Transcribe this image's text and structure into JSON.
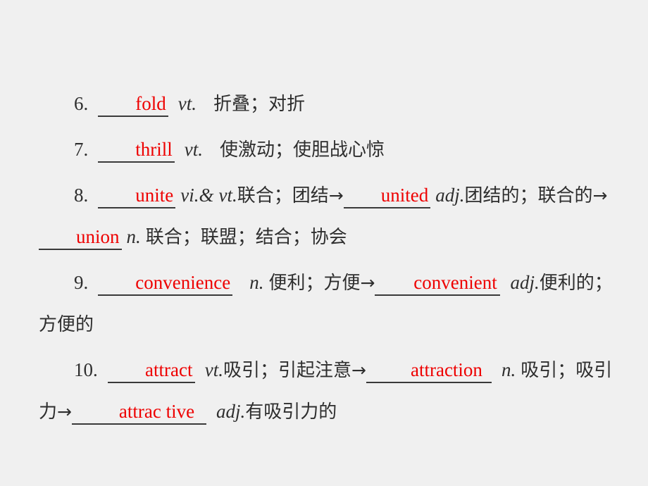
{
  "slide": {
    "background_color": "#f0f0f0",
    "answer_color": "#ee0000",
    "text_color": "#2e2e2e",
    "rule_color": "#3a3a3a",
    "arrow_glyph": "→"
  },
  "entries": [
    {
      "number": "6.",
      "answer": "fold",
      "pos": "vt.",
      "gloss": "折叠；对折",
      "derivations": []
    },
    {
      "number": "7.",
      "answer": "thrill",
      "pos": "vt.",
      "gloss": "使激动；使胆战心惊",
      "derivations": []
    },
    {
      "number": "8.",
      "answer": "unite",
      "pos_a": "vi.&",
      "pos_b": "vt.",
      "gloss": "联合；团结",
      "derivations": [
        {
          "answer": "united",
          "pos": "adj.",
          "gloss": "团结的；联合的"
        },
        {
          "answer": "union",
          "pos": "n.",
          "gloss": "联合；联盟；结合；协会"
        }
      ]
    },
    {
      "number": "9.",
      "answer": "convenience",
      "pos": "n.",
      "gloss": "便利；方便",
      "derivations": [
        {
          "answer": "convenient",
          "pos": "adj.",
          "gloss": "便利的；方便的"
        }
      ]
    },
    {
      "number": "10.",
      "answer": "attract",
      "pos": "vt.",
      "gloss": "吸引；引起注意",
      "derivations": [
        {
          "answer": "attraction",
          "pos": "n.",
          "gloss": "吸引；吸引力"
        },
        {
          "answer": "attrac tive",
          "pos": "adj.",
          "gloss": "有吸引力的"
        }
      ]
    }
  ]
}
